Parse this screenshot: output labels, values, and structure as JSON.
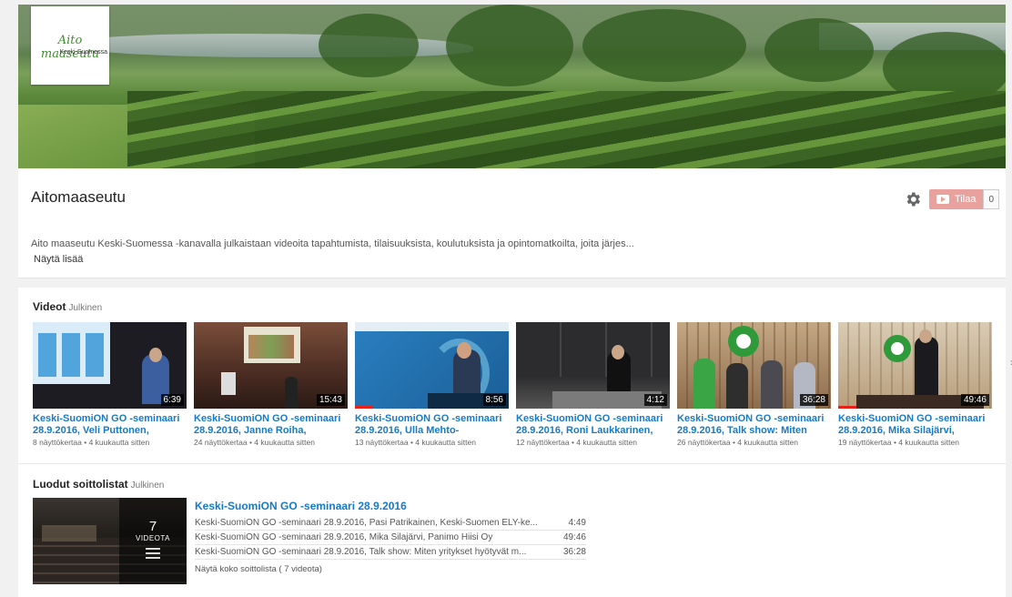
{
  "channel": {
    "logo_line1": "Aito maaseutu",
    "logo_line2": "Keski-Suomessa",
    "title": "Aitomaaseutu",
    "subscribe_label": "Tilaa",
    "subscriber_count": "0",
    "description": "Aito maaseutu Keski-Suomessa -kanavalla julkaistaan videoita tapahtumista, tilaisuuksista, koulutuksista ja opintomatkoilta, joita järjes...",
    "show_more": "Näytä lisää",
    "settings_icon": "gear-icon",
    "accent_color": "#167ac6"
  },
  "videos_section": {
    "title": "Videot",
    "visibility": "Julkinen",
    "items": [
      {
        "title": "Keski-SuomiON GO -seminaari 28.9.2016, Veli Puttonen, Keski-...",
        "duration": "6:39",
        "meta": "8 näyttökertaa • 4 kuukautta sitten",
        "progress": 0
      },
      {
        "title": "Keski-SuomiON GO -seminaari 28.9.2016, Janne Roiha, Kasvur...",
        "duration": "15:43",
        "meta": "24 näyttökertaa • 4 kuukautta sitten",
        "progress": 0
      },
      {
        "title": "Keski-SuomiON GO -seminaari 28.9.2016, Ulla Mehto-",
        "duration": "8:56",
        "meta": "13 näyttökertaa • 4 kuukautta sitten",
        "progress": 0.12
      },
      {
        "title": "Keski-SuomiON GO -seminaari 28.9.2016, Roni Laukkarinen,",
        "duration": "4:12",
        "meta": "12 näyttökertaa • 4 kuukautta sitten",
        "progress": 0
      },
      {
        "title": "Keski-SuomiON GO -seminaari 28.9.2016, Talk show: Miten",
        "duration": "36:28",
        "meta": "26 näyttökertaa • 4 kuukautta sitten",
        "progress": 0
      },
      {
        "title": "Keski-SuomiON GO -seminaari 28.9.2016, Mika Silajärvi, Panim...",
        "duration": "49:46",
        "meta": "19 näyttökertaa • 4 kuukautta sitten",
        "progress": 0.12
      }
    ],
    "next_icon": "chevron-right-icon"
  },
  "playlists_section": {
    "title": "Luodut soittolistat",
    "visibility": "Julkinen",
    "playlist": {
      "count": "7",
      "count_label": "VIDEOTA",
      "title": "Keski-SuomiON GO -seminaari 28.9.2016",
      "items": [
        {
          "title": "Keski-SuomiON GO -seminaari 28.9.2016, Pasi Patrikainen, Keski-Suomen ELY-ke...",
          "duration": "4:49"
        },
        {
          "title": "Keski-SuomiON GO -seminaari 28.9.2016, Mika Silajärvi, Panimo Hiisi Oy",
          "duration": "49:46"
        },
        {
          "title": "Keski-SuomiON GO -seminaari 28.9.2016, Talk show: Miten yritykset hyötyvät m...",
          "duration": "36:28"
        }
      ],
      "show_all": "Näytä koko soittolista ( 7 videota)"
    }
  }
}
